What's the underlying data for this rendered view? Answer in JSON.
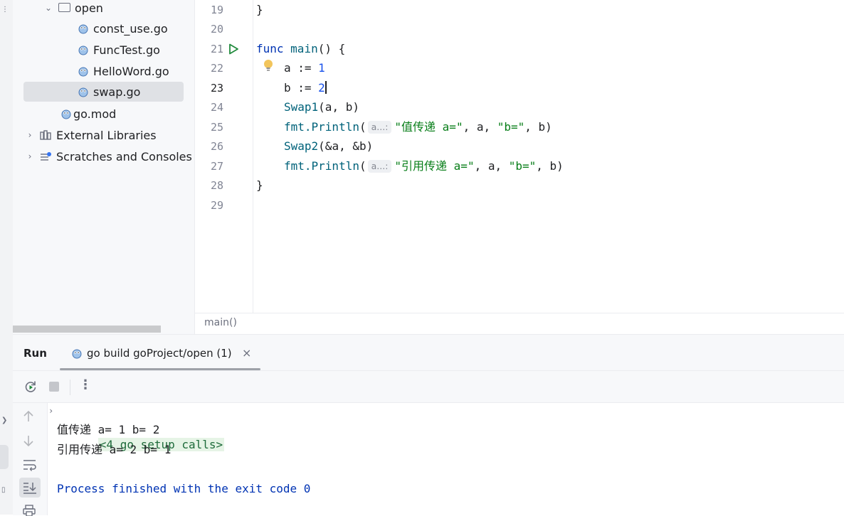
{
  "project_tree": {
    "items": [
      {
        "label": "open",
        "type": "folder",
        "expanded": true
      },
      {
        "label": "const_use.go",
        "type": "go-file"
      },
      {
        "label": "FuncTest.go",
        "type": "go-file"
      },
      {
        "label": "HelloWord.go",
        "type": "go-file"
      },
      {
        "label": "swap.go",
        "type": "go-file",
        "selected": true
      },
      {
        "label": "go.mod",
        "type": "go-mod"
      },
      {
        "label": "External Libraries",
        "type": "library"
      },
      {
        "label": "Scratches and Consoles",
        "type": "scratches"
      }
    ]
  },
  "editor": {
    "line_numbers": [
      "19",
      "20",
      "21",
      "22",
      "23",
      "24",
      "25",
      "26",
      "27",
      "28",
      "29"
    ],
    "current_line": "23",
    "lines": {
      "l19_brace": "}",
      "l21_func": "func",
      "l21_name": "main",
      "l21_rest": "() {",
      "l22_var": "a",
      "l22_op": " := ",
      "l22_val": "1",
      "l23_var": "b",
      "l23_op": " := ",
      "l23_val": "2",
      "l24_call": "Swap1",
      "l24_args": "(a, b)",
      "l25_pkg": "fmt.",
      "l25_call": "Println",
      "l25_open": "(",
      "l25_hint": "a...:",
      "l25_str1": "\"值传递 a=\"",
      "l25_mid": ", a, ",
      "l25_str2": "\"b=\"",
      "l25_end": ", b)",
      "l26_call": "Swap2",
      "l26_args": "(&a, &b)",
      "l27_pkg": "fmt.",
      "l27_call": "Println",
      "l27_open": "(",
      "l27_hint": "a...:",
      "l27_str1": "\"引用传递 a=\"",
      "l27_mid": ", a, ",
      "l27_str2": "\"b=\"",
      "l27_end": ", b)",
      "l28_brace": "}"
    }
  },
  "breadcrumb": "main()",
  "run_panel": {
    "title": "Run",
    "tab_label": "go build goProject/open (1)",
    "console": {
      "setup_calls": "<4 go setup calls>",
      "output_1": "值传递 a= 1 b= 2",
      "output_2": "引用传递 a= 2 b= 1",
      "process": "Process finished with the exit code 0"
    }
  },
  "colors": {
    "keyword": "#0033b3",
    "function": "#00627a",
    "number": "#1750eb",
    "string": "#067d17",
    "run_green": "#208a3c"
  }
}
